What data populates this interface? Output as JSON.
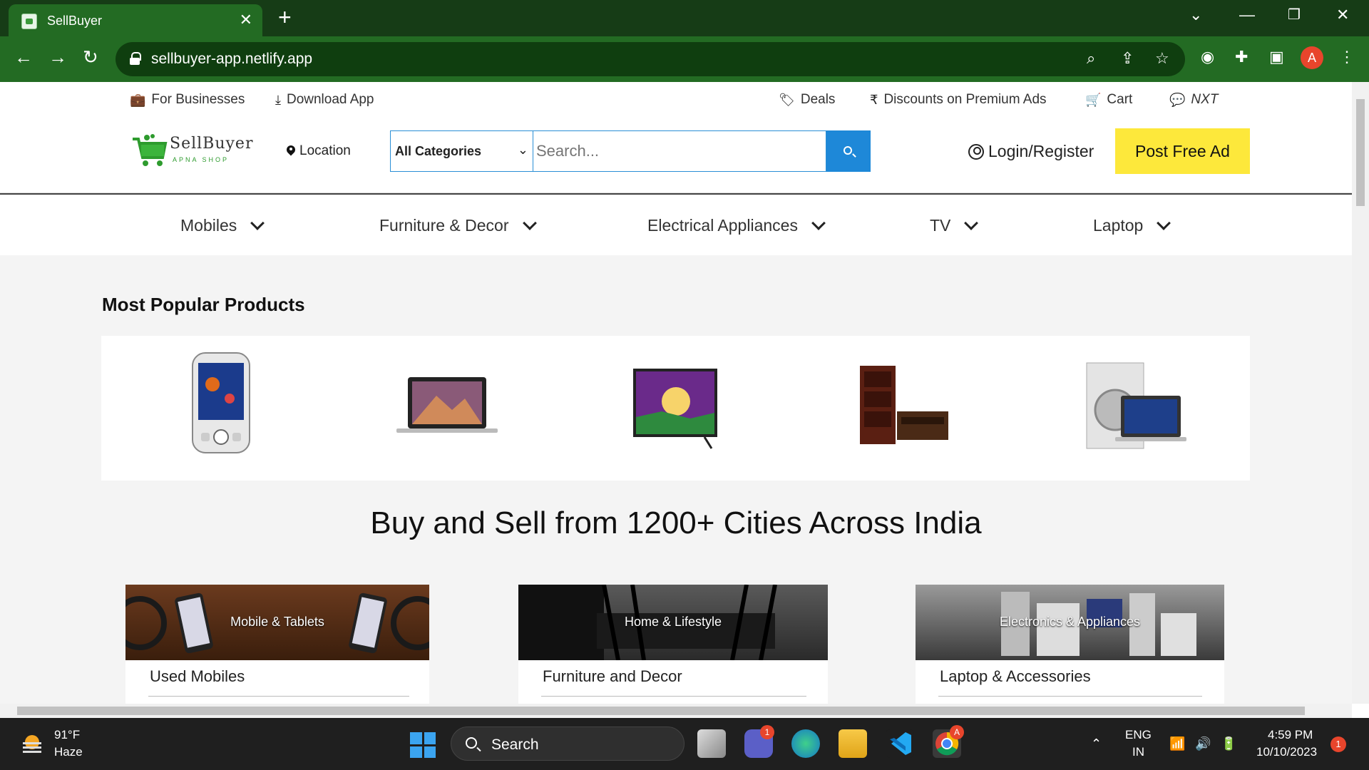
{
  "browser": {
    "tab_title": "SellBuyer",
    "url": "sellbuyer-app.netlify.app",
    "profile_initial": "A",
    "icons": [
      "favicon",
      "close-icon",
      "plus-icon",
      "chevron-down-icon",
      "minimize-icon",
      "restore-icon",
      "close-window-icon",
      "back-icon",
      "forward-icon",
      "reload-icon",
      "lock-icon",
      "zoom-icon",
      "share-icon",
      "star-icon",
      "extension-icon",
      "puzzle-icon",
      "sidebar-icon",
      "more-icon"
    ]
  },
  "header": {
    "top_links": {
      "for_businesses": "For Businesses",
      "download_app": "Download App",
      "deals": "Deals",
      "discounts": "Discounts on Premium Ads",
      "cart": "Cart",
      "nxt": "NXT"
    },
    "logo": {
      "name": "SellBuyer",
      "tagline": "APNA SHOP"
    },
    "location_label": "Location",
    "category_select": "All Categories",
    "search_placeholder": "Search...",
    "login_label": "Login/Register",
    "post_ad_label": "Post Free Ad"
  },
  "category_nav": [
    "Mobiles",
    "Furniture & Decor",
    "Electrical Appliances",
    "TV",
    "Laptop"
  ],
  "popular": {
    "title": "Most Popular Products",
    "products": [
      "mobile-phone",
      "laptop",
      "television",
      "furniture",
      "electronics"
    ]
  },
  "headline": "Buy and Sell from 1200+ Cities Across India",
  "category_cards": [
    {
      "banner": "Mobile & Tablets",
      "title": "Used Mobiles"
    },
    {
      "banner": "Home & Lifestyle",
      "title": "Furniture and Decor"
    },
    {
      "banner": "Electronics & Appliances",
      "title": "Laptop & Accessories"
    }
  ],
  "taskbar": {
    "temperature": "91°F",
    "weather": "Haze",
    "search_label": "Search",
    "language": "ENG",
    "region": "IN",
    "time": "4:59 PM",
    "date": "10/10/2023",
    "teams_badge": "1",
    "chrome_badge": "A",
    "notification_count": "1"
  },
  "colors": {
    "tab_bar": "#163c16",
    "toolbar": "#236b23",
    "search_button": "#1e88d8",
    "post_ad": "#fde83b",
    "brand_green": "#2e9b2e"
  }
}
